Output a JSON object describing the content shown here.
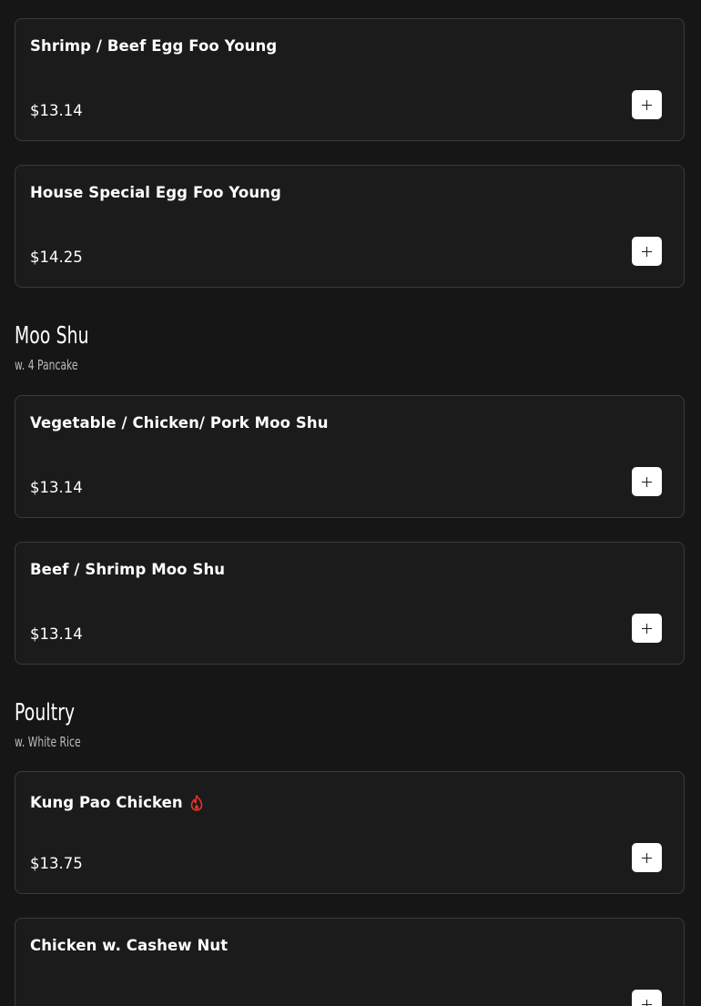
{
  "items_top": [
    {
      "name": "Shrimp / Beef Egg Foo Young",
      "price": "$13.14"
    },
    {
      "name": "House Special Egg Foo Young",
      "price": "$14.25"
    }
  ],
  "sections": [
    {
      "title": "Moo Shu",
      "subtitle": "w. 4 Pancake",
      "items": [
        {
          "name": "Vegetable / Chicken/ Pork Moo Shu",
          "price": "$13.14"
        },
        {
          "name": "Beef / Shrimp Moo Shu",
          "price": "$13.14"
        }
      ]
    },
    {
      "title": "Poultry",
      "subtitle": "w. White Rice",
      "items": [
        {
          "name": "Kung Pao Chicken",
          "price": "$13.75",
          "icon": "spicy-flame-icon",
          "icon_color": "#e0352b"
        },
        {
          "name": "Chicken w. Cashew Nut",
          "price": ""
        }
      ]
    }
  ],
  "add_button_icon": "plus-icon",
  "colors": {
    "background": "#161616",
    "card": "#1b1b1b",
    "card_border": "#3a3a3a",
    "button": "#ffffff",
    "spicy": "#e0352b"
  }
}
